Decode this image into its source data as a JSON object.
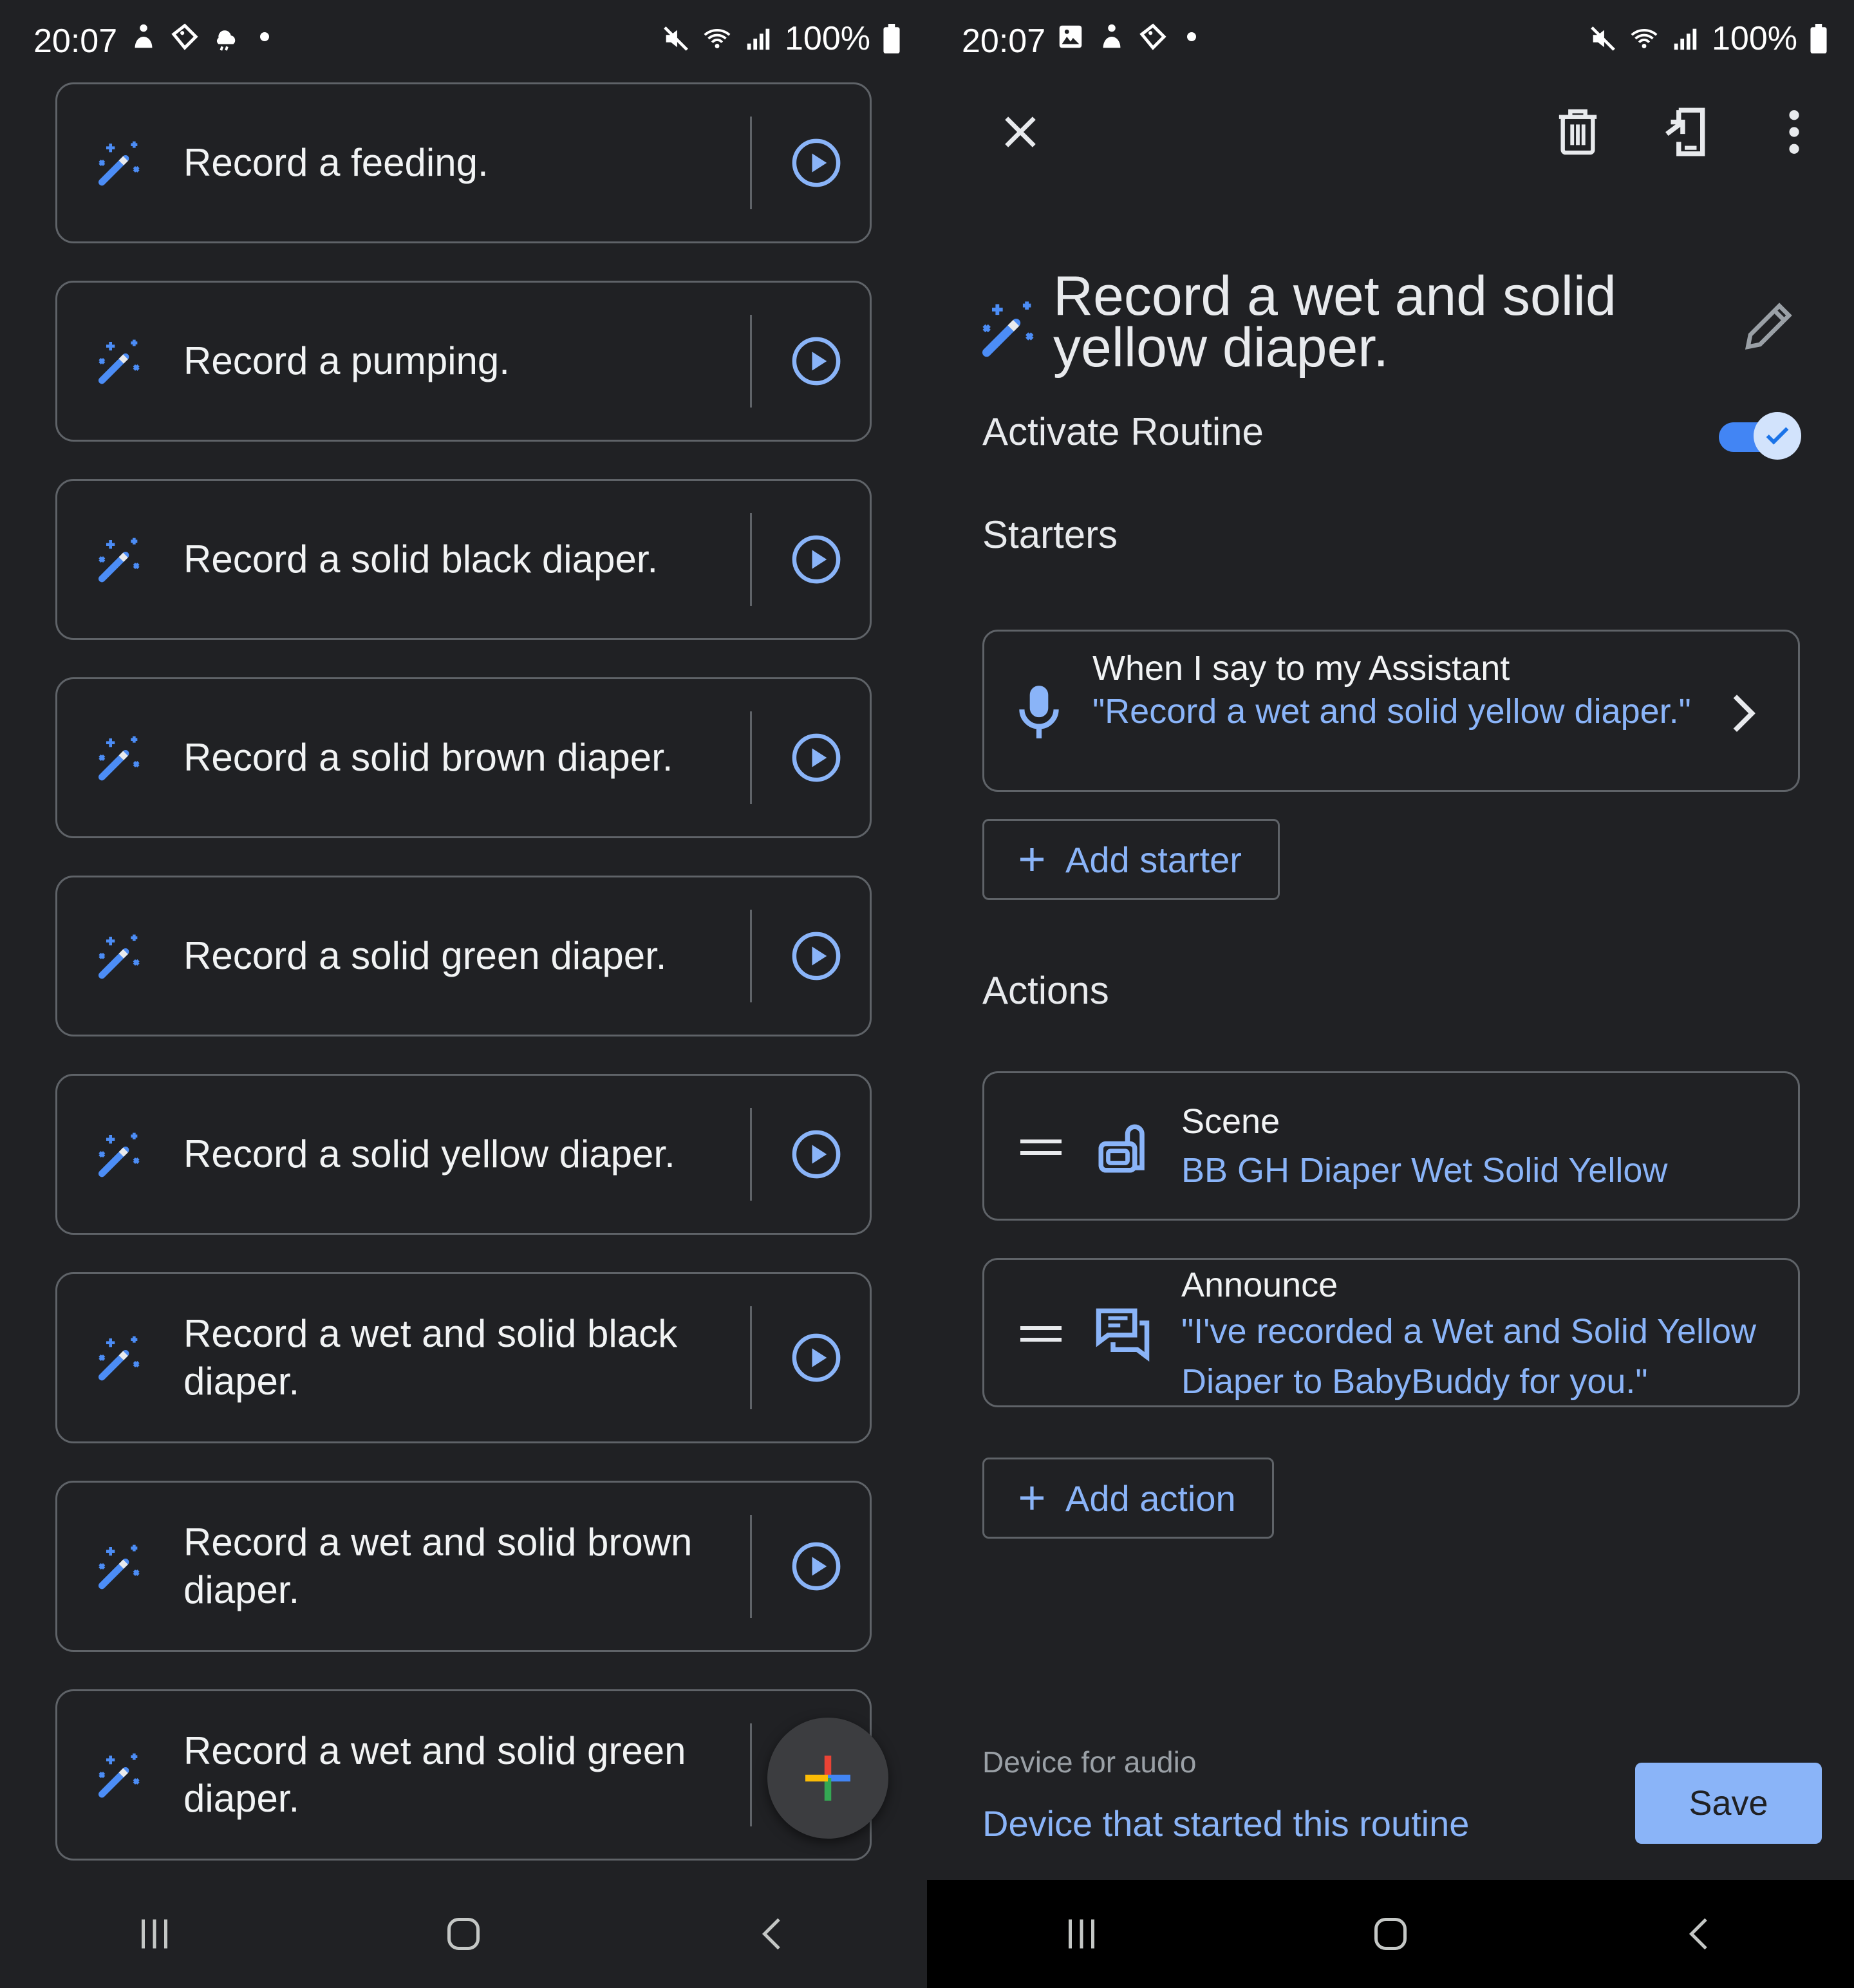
{
  "left": {
    "status": {
      "time": "20:07",
      "battery": "100%"
    },
    "routines": [
      {
        "label": "Record a feeding."
      },
      {
        "label": "Record a pumping."
      },
      {
        "label": "Record a solid black diaper."
      },
      {
        "label": "Record a solid brown diaper."
      },
      {
        "label": "Record a solid green diaper."
      },
      {
        "label": "Record a solid yellow diaper."
      },
      {
        "label": "Record a wet and solid black diaper."
      },
      {
        "label": "Record a wet and solid brown diaper."
      },
      {
        "label": "Record a wet and solid green diaper."
      }
    ],
    "fab_icon": "plus-icon"
  },
  "right": {
    "status": {
      "time": "20:07",
      "battery": "100%"
    },
    "title": "Record a wet and solid yellow diaper.",
    "activate_label": "Activate Routine",
    "activate_on": true,
    "starters_heading": "Starters",
    "starter": {
      "line1": "When I say to my Assistant",
      "phrase": "\"Record a wet and solid yellow diaper.\""
    },
    "add_starter_label": "Add starter",
    "actions_heading": "Actions",
    "actions": [
      {
        "name": "Scene",
        "detail": "BB GH Diaper Wet Solid Yellow",
        "icon": "scene-icon"
      },
      {
        "name": "Announce",
        "detail": "\"I've recorded a Wet and Solid Yellow Diaper to BabyBuddy for you.\"",
        "icon": "announce-icon"
      }
    ],
    "add_action_label": "Add action",
    "device_label": "Device for audio",
    "device_value": "Device that started this routine",
    "save_label": "Save"
  },
  "colors": {
    "accent": "#8ab4f8",
    "toggle": "#4285f4",
    "background": "#202124",
    "border": "#5f6368"
  }
}
